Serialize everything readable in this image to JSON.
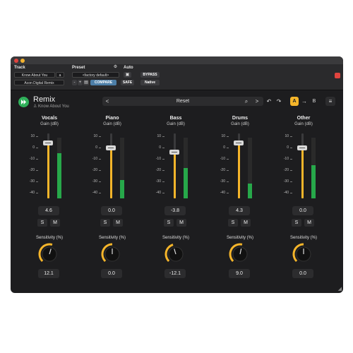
{
  "header": {
    "track_label": "Track",
    "preset_label": "Preset",
    "auto_label": "Auto",
    "track_select": "Know About You",
    "track_slot": "a",
    "insert_select": "Acon Digital Remix",
    "preset_select": "<factory default>",
    "compare_label": "COMPARE",
    "bypass_label": "BYPASS",
    "safe_label": "SAFE",
    "native_label": "Native",
    "nav_minus": "-",
    "nav_plus": "+"
  },
  "plugin": {
    "title": "Remix",
    "subtitle": "Know About You",
    "preset_name": "Reset",
    "prev": "<",
    "next": ">",
    "undo": "↶",
    "redo": "↷",
    "a_label": "A",
    "arrow": "→",
    "b_label": "B",
    "menu": "≡"
  },
  "scale_ticks": [
    "10",
    "0",
    "-10",
    "-20",
    "-30",
    "-40"
  ],
  "strips": [
    {
      "name": "Vocals",
      "gain_label": "Gain (dB)",
      "gain": "4.6",
      "gain_value": 4.6,
      "meter_level": 0.75,
      "mute": "M",
      "solo": "S",
      "sensitivity_label": "Sensitivity (%)",
      "sensitivity": "12.1",
      "sensitivity_value": 12.1
    },
    {
      "name": "Piano",
      "gain_label": "Gain (dB)",
      "gain": "0.0",
      "gain_value": 0.0,
      "meter_level": 0.3,
      "mute": "M",
      "solo": "S",
      "sensitivity_label": "Sensitivity (%)",
      "sensitivity": "0.0",
      "sensitivity_value": 0.0
    },
    {
      "name": "Bass",
      "gain_label": "Gain (dB)",
      "gain": "-3.8",
      "gain_value": -3.8,
      "meter_level": 0.5,
      "mute": "M",
      "solo": "S",
      "sensitivity_label": "Sensitivity (%)",
      "sensitivity": "-12.1",
      "sensitivity_value": -12.1
    },
    {
      "name": "Drums",
      "gain_label": "Gain (dB)",
      "gain": "4.3",
      "gain_value": 4.3,
      "meter_level": 0.25,
      "mute": "M",
      "solo": "S",
      "sensitivity_label": "Sensitivity (%)",
      "sensitivity": "9.0",
      "sensitivity_value": 9.0
    },
    {
      "name": "Other",
      "gain_label": "Gain (dB)",
      "gain": "0.0",
      "gain_value": 0.0,
      "meter_level": 0.55,
      "mute": "M",
      "solo": "S",
      "sensitivity_label": "Sensitivity (%)",
      "sensitivity": "0.0",
      "sensitivity_value": 0.0
    }
  ],
  "colors": {
    "accent": "#f5b52a",
    "meter": "#27a84a",
    "logo": "#2fb05a",
    "close": "#e0443e",
    "minimize": "#f2b230"
  }
}
